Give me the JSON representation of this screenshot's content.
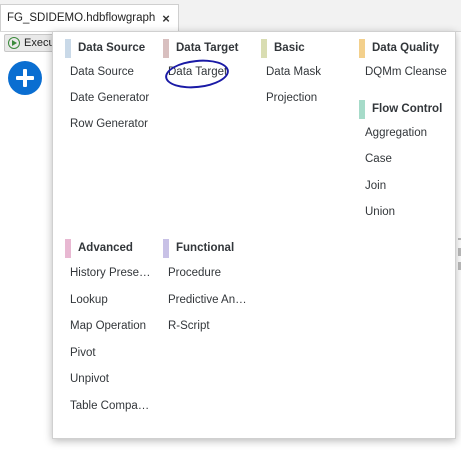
{
  "tab": {
    "title": "FG_SDIDEMO.hdbflowgraph",
    "close_label": "×"
  },
  "toolbar": {
    "execute_label": "Execu"
  },
  "colors": {
    "accent": "#0a6ed1",
    "data_source": "#c9d9e8",
    "data_target": "#d8bfbf",
    "basic": "#d9ddb2",
    "data_quality": "#f3d08c",
    "flow_control": "#a6dbc9",
    "advanced": "#e8b8d2",
    "functional": "#c8c1e6"
  },
  "palette": {
    "sections": {
      "data_source": {
        "title": "Data Source",
        "items": [
          "Data Source",
          "Date Generator",
          "Row Generator"
        ]
      },
      "data_target": {
        "title": "Data Target",
        "items": [
          "Data Target"
        ]
      },
      "basic": {
        "title": "Basic",
        "items": [
          "Data Mask",
          "Projection"
        ]
      },
      "data_quality": {
        "title": "Data Quality",
        "items": [
          "DQMm Cleanse"
        ]
      },
      "flow_control": {
        "title": "Flow Control",
        "items": [
          "Aggregation",
          "Case",
          "Join",
          "Union"
        ]
      },
      "advanced": {
        "title": "Advanced",
        "items": [
          "History Prese…",
          "Lookup",
          "Map Operation",
          "Pivot",
          "Unpivot",
          "Table Compa…"
        ]
      },
      "functional": {
        "title": "Functional",
        "items": [
          "Procedure",
          "Predictive An…",
          "R-Script"
        ]
      }
    }
  }
}
